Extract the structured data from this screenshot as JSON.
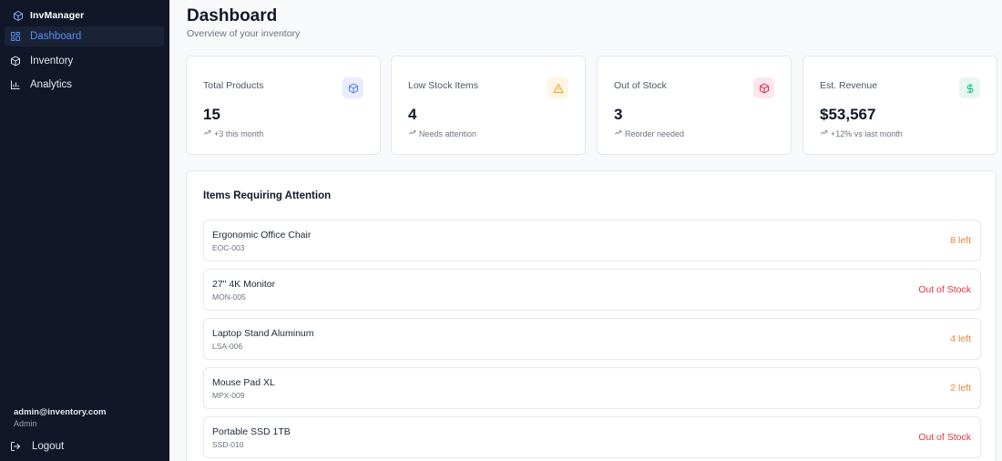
{
  "brand": {
    "name": "InvManager",
    "icon": "cube-icon"
  },
  "nav": [
    {
      "label": "Dashboard",
      "icon": "grid-icon",
      "active": true
    },
    {
      "label": "Inventory",
      "icon": "cube-icon",
      "active": false
    },
    {
      "label": "Analytics",
      "icon": "bar-chart-icon",
      "active": false
    }
  ],
  "user": {
    "email": "admin@inventory.com",
    "role": "Admin"
  },
  "logout": {
    "label": "Logout",
    "icon": "logout-icon"
  },
  "header": {
    "title": "Dashboard",
    "subtitle": "Overview of your inventory"
  },
  "stats": [
    {
      "label": "Total Products",
      "value": "15",
      "foot": "+3 this month",
      "icon": "cube-icon",
      "icon_color": "#4f6ef5",
      "icon_bg": "#e8edff"
    },
    {
      "label": "Low Stock Items",
      "value": "4",
      "foot": "Needs attention",
      "icon": "warning-icon",
      "icon_color": "#f59e0b",
      "icon_bg": "#fff4e5"
    },
    {
      "label": "Out of Stock",
      "value": "3",
      "foot": "Reorder needed",
      "icon": "cube-icon",
      "icon_color": "#e11d48",
      "icon_bg": "#fde7ea"
    },
    {
      "label": "Est. Revenue",
      "value": "$53,567",
      "foot": "+12% vs last month",
      "icon": "dollar-icon",
      "icon_color": "#10b981",
      "icon_bg": "#e6f7f0"
    }
  ],
  "attention": {
    "title": "Items Requiring Attention",
    "items": [
      {
        "name": "Ergonomic Office Chair",
        "sku": "EOC-003",
        "status": "8 left",
        "level": "low"
      },
      {
        "name": "27\" 4K Monitor",
        "sku": "MON-005",
        "status": "Out of Stock",
        "level": "out"
      },
      {
        "name": "Laptop Stand Aluminum",
        "sku": "LSA-006",
        "status": "4 left",
        "level": "low"
      },
      {
        "name": "Mouse Pad XL",
        "sku": "MPX-009",
        "status": "2 left",
        "level": "low"
      },
      {
        "name": "Portable SSD 1TB",
        "sku": "SSD-010",
        "status": "Out of Stock",
        "level": "out"
      }
    ]
  },
  "colors": {
    "sidebar_bg": "#111729",
    "active_nav": "#5b8def",
    "low_stock": "#e9853a",
    "out_of_stock": "#dc3545"
  }
}
